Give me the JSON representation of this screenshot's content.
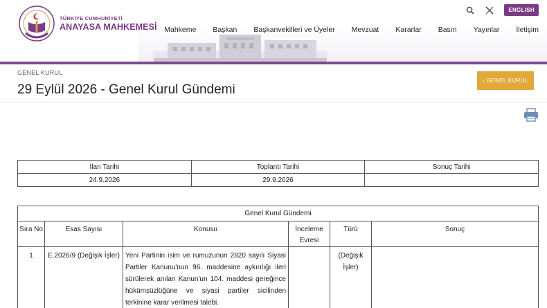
{
  "header": {
    "brand_line1": "TÜRKİYE CUMHURİYETİ",
    "brand_line2": "ANAYASA MAHKEMESİ",
    "language_button": "ENGLISH",
    "nav": [
      "Mahkeme",
      "Başkan",
      "Başkanvekilleri ve Üyeler",
      "Mevzuat",
      "Kararlar",
      "Basın",
      "Yayınlar",
      "İletişim"
    ],
    "icons": {
      "search": "search-icon",
      "x": "x-social-icon"
    },
    "accent_color": "#7a3b86"
  },
  "title_band": {
    "breadcrumb": "GENEL KURUL",
    "title": "29 Eylül 2026 - Genel Kurul Gündemi",
    "back_button": "‹ GENEL KURUL",
    "back_button_color": "#e0a93a"
  },
  "dates_table": {
    "headers": [
      "İlan Tarihi",
      "Toplantı Tarihi",
      "Sonuç Tarihi"
    ],
    "values": [
      "24.9.2026",
      "29.9.2026",
      ""
    ]
  },
  "agenda_table": {
    "caption": "Genel Kurul Gündemi",
    "headers": {
      "sira": "Sıra No",
      "esas": "Esas Sayısı",
      "konu": "Konusu",
      "inceleme_1": "İnceleme",
      "inceleme_2": "Evresi",
      "turu": "Türü",
      "sonuc": "Sonuç"
    },
    "rows": [
      {
        "sira": "1",
        "esas": "E.2026/9 (Değişik İşler)",
        "konu": "Yeni Partinin isim ve rumuzunun 2820 sayılı Siyasi Partiler Kanunu'nun 96. maddesine aykırılığı ileri sürülerek anılan Kanun'un 104. maddesi gereğince hükümsüzlüğüne ve siyasi partiler sicilinden terkinine karar verilmesi talebi.",
        "inceleme": "",
        "turu": "(Değişik İşler)",
        "sonuc": ""
      }
    ]
  }
}
